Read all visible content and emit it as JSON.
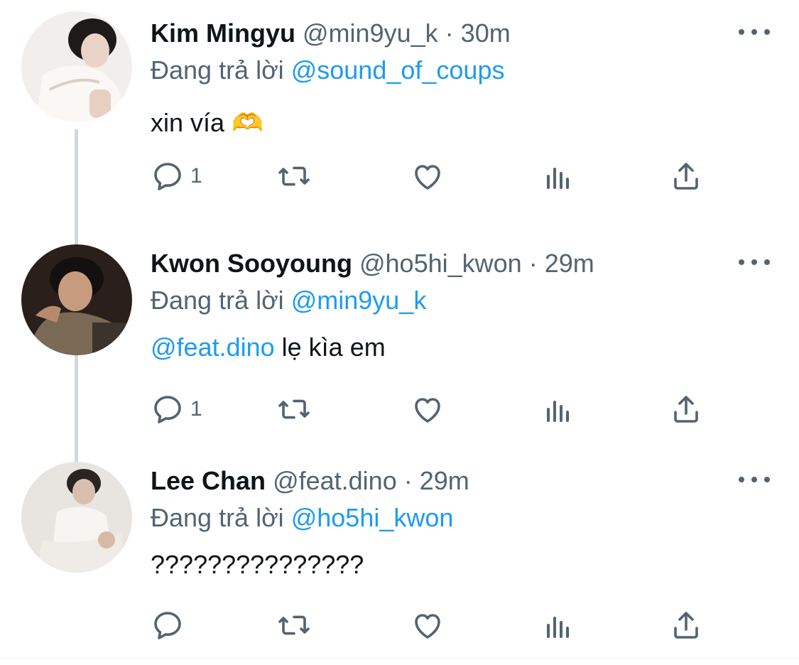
{
  "reply_prefix": "Đang trả lời",
  "tweets": [
    {
      "name": "Kim Mingyu",
      "handle": "@min9yu_k",
      "sep": "·",
      "time": "30m",
      "reply_to": "@sound_of_coups",
      "text": "xin vía 🫶",
      "mention": "",
      "reply_count": "1"
    },
    {
      "name": "Kwon Sooyoung",
      "handle": "@ho5hi_kwon",
      "sep": "·",
      "time": "29m",
      "reply_to": "@min9yu_k",
      "mention": "@feat.dino",
      "text": " lẹ kìa em",
      "reply_count": "1"
    },
    {
      "name": "Lee Chan",
      "handle": "@feat.dino",
      "sep": "·",
      "time": "29m",
      "reply_to": "@ho5hi_kwon",
      "mention": "",
      "text": "???????????????",
      "reply_count": ""
    }
  ],
  "colors": {
    "accent": "#1d9bf0",
    "muted": "#536471",
    "text": "#0f1419",
    "thread": "#cfd9de"
  }
}
